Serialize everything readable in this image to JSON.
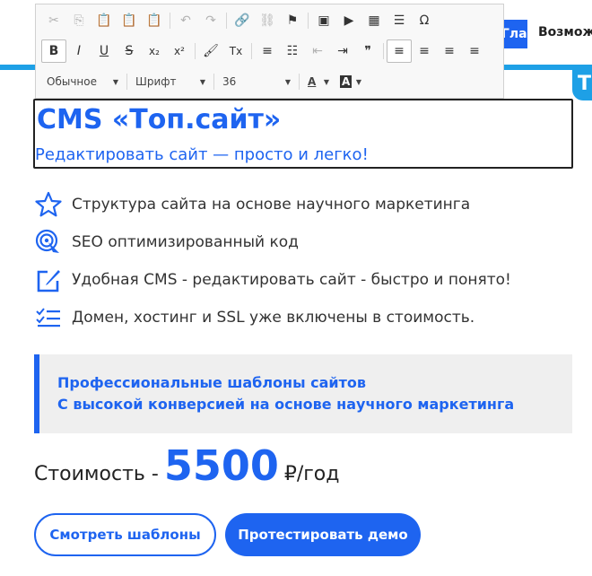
{
  "header": {
    "nav_active_label": "Главная",
    "nav_item_label": "Возможности",
    "badge_text": "Т"
  },
  "toolbar": {
    "row1": [
      {
        "name": "cut-icon",
        "glyph": "✂",
        "enabled": false
      },
      {
        "name": "copy-icon",
        "glyph": "⎘",
        "enabled": false
      },
      {
        "name": "paste-icon",
        "glyph": "📋",
        "enabled": true
      },
      {
        "name": "paste-text-icon",
        "glyph": "📋",
        "enabled": true
      },
      {
        "name": "paste-word-icon",
        "glyph": "📋",
        "enabled": true
      },
      {
        "name": "undo-icon",
        "glyph": "↶",
        "enabled": false
      },
      {
        "name": "redo-icon",
        "glyph": "↷",
        "enabled": false
      },
      {
        "name": "link-icon",
        "glyph": "🔗",
        "enabled": true
      },
      {
        "name": "unlink-icon",
        "glyph": "⛓",
        "enabled": false
      },
      {
        "name": "anchor-flag-icon",
        "glyph": "⚑",
        "enabled": true
      },
      {
        "name": "image-icon",
        "glyph": "▣",
        "enabled": true
      },
      {
        "name": "video-icon",
        "glyph": "▶",
        "enabled": true
      },
      {
        "name": "table-icon",
        "glyph": "▦",
        "enabled": true
      },
      {
        "name": "horizontal-line-icon",
        "glyph": "☰",
        "enabled": true
      },
      {
        "name": "special-char-icon",
        "glyph": "Ω",
        "enabled": true
      }
    ],
    "row2": [
      {
        "name": "bold-icon",
        "glyph": "B",
        "enabled": true,
        "active": true
      },
      {
        "name": "italic-icon",
        "glyph": "I",
        "enabled": true
      },
      {
        "name": "underline-icon",
        "glyph": "U",
        "enabled": true
      },
      {
        "name": "strikethrough-icon",
        "glyph": "S",
        "enabled": true
      },
      {
        "name": "subscript-icon",
        "glyph": "x₂",
        "enabled": true
      },
      {
        "name": "superscript-icon",
        "glyph": "x²",
        "enabled": true
      },
      {
        "name": "copy-format-icon",
        "glyph": "🖌",
        "enabled": true
      },
      {
        "name": "remove-format-icon",
        "glyph": "Tx",
        "enabled": true
      },
      {
        "name": "numbered-list-icon",
        "glyph": "≡",
        "enabled": true
      },
      {
        "name": "bulleted-list-icon",
        "glyph": "☷",
        "enabled": true
      },
      {
        "name": "outdent-icon",
        "glyph": "⇤",
        "enabled": false
      },
      {
        "name": "indent-icon",
        "glyph": "⇥",
        "enabled": true
      },
      {
        "name": "blockquote-icon",
        "glyph": "❞",
        "enabled": true
      },
      {
        "name": "align-left-icon",
        "glyph": "≡",
        "enabled": true,
        "active": true
      },
      {
        "name": "align-center-icon",
        "glyph": "≡",
        "enabled": true
      },
      {
        "name": "align-right-icon",
        "glyph": "≡",
        "enabled": true
      },
      {
        "name": "align-justify-icon",
        "glyph": "≡",
        "enabled": true
      }
    ],
    "format_select": "Обычное",
    "font_select": "Шрифт",
    "size_select": "36",
    "text_color_label": "A",
    "bg_color_label": "A"
  },
  "editor": {
    "title": "CMS «Топ.сайт»",
    "subtitle": "Редактировать сайт — просто и легко!"
  },
  "features": [
    {
      "icon": "star-icon",
      "text": "Структура сайта на основе научного маркетинга"
    },
    {
      "icon": "target-cursor-icon",
      "text": "SEO оптимизированный код"
    },
    {
      "icon": "edit-square-icon",
      "text": "Удобная CMS - редактировать сайт - быстро и понято!"
    },
    {
      "icon": "checklist-icon",
      "text": "Домен, хостинг и SSL уже включены в стоимость."
    }
  ],
  "promo": {
    "line1": "Профессиональные шаблоны сайтов",
    "line2": "С высокой конверсией на основе научного маркетинга"
  },
  "price": {
    "label": "Стоимость -",
    "value": "5500",
    "unit": "₽/год"
  },
  "buttons": {
    "templates": "Смотреть шаблоны",
    "demo": "Протестировать демо"
  },
  "colors": {
    "accent": "#1e64f0",
    "header_line": "#1ea0e6",
    "promo_bg": "#efefef"
  }
}
